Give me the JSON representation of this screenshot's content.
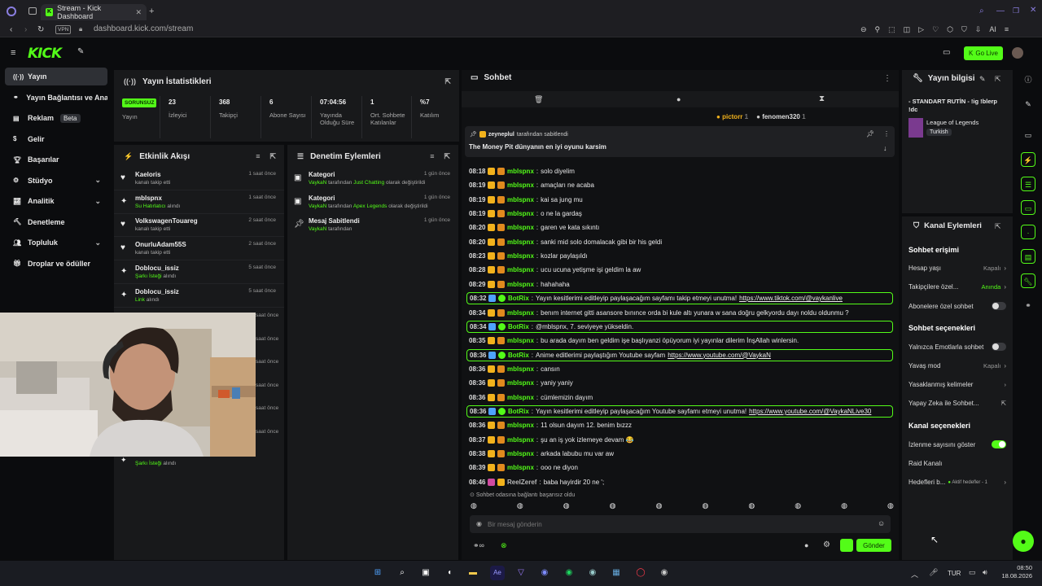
{
  "browser": {
    "tab_title": "Stream - Kick Dashboard",
    "url": "dashboard.kick.com/stream",
    "vpn": "VPN",
    "ai": "AI"
  },
  "header": {
    "logo": "KICK",
    "go_live": "Go Live"
  },
  "sidebar": {
    "items": [
      {
        "label": "Yayın",
        "icon": "broadcast-icon",
        "active": true
      },
      {
        "label": "Yayın Bağlantısı ve Anahtarı",
        "icon": "link-icon"
      },
      {
        "label": "Reklam",
        "icon": "ad-icon",
        "badge": "Beta"
      },
      {
        "label": "Gelir",
        "icon": "dollar-icon"
      },
      {
        "label": "Başarılar",
        "icon": "trophy-icon"
      },
      {
        "label": "Stüdyo",
        "icon": "studio-icon",
        "expand": true
      },
      {
        "label": "Analitik",
        "icon": "chart-icon",
        "expand": true
      },
      {
        "label": "Denetleme",
        "icon": "hammer-icon"
      },
      {
        "label": "Topluluk",
        "icon": "community-icon",
        "expand": true
      },
      {
        "label": "Droplar ve ödüller",
        "icon": "gift-icon"
      }
    ]
  },
  "stats": {
    "title": "Yayın İstatistikleri",
    "status_badge": "SORUNSUZ",
    "items": [
      {
        "value": "",
        "label": "Yayın"
      },
      {
        "value": "23",
        "label": "İzleyici"
      },
      {
        "value": "368",
        "label": "Takipçi"
      },
      {
        "value": "6",
        "label": "Abone Sayısı"
      },
      {
        "value": "07:04:56",
        "label": "Yayında Olduğu Süre"
      },
      {
        "value": "1",
        "label": "Ort. Sohbete Katılanlar"
      },
      {
        "value": "%7",
        "label": "Katılım"
      }
    ]
  },
  "activity": {
    "title": "Etkinlik Akışı",
    "items": [
      {
        "name": "Kaeloris",
        "sub": "kanalı takip etti",
        "time": "1 saat önce",
        "icon": "heart-icon"
      },
      {
        "name": "mblspnx",
        "sub_green": "Su Hatırlatıcı",
        "sub": "alındı",
        "time": "1 saat önce",
        "icon": "reward-icon"
      },
      {
        "name": "VolkswagenTouareg",
        "sub": "kanalı takip etti",
        "time": "2 saat önce",
        "icon": "heart-icon"
      },
      {
        "name": "OnurluAdam55S",
        "sub": "kanalı takip etti",
        "time": "2 saat önce",
        "icon": "heart-icon"
      },
      {
        "name": "Doblocu_issiz",
        "sub_green": "Şarkı İsteği",
        "sub": "alındı",
        "time": "5 saat önce",
        "icon": "reward-icon"
      },
      {
        "name": "Doblocu_issiz",
        "sub_green": "Link",
        "sub": "alındı",
        "time": "5 saat önce",
        "icon": "reward-icon"
      }
    ],
    "hidden_times": [
      "saat önce",
      "saat önce",
      "saat önce",
      "saat önce",
      "saat önce",
      "saat önce"
    ],
    "last_sub_green": "Şarkı İsteği",
    "last_sub": "alındı"
  },
  "moderation": {
    "title": "Denetim Eylemleri",
    "items": [
      {
        "name": "Kategori",
        "actor": "VaykaN",
        "mid": "tarafından",
        "target": "Just Chatting",
        "tail": "olarak değiştirildi",
        "time": "1 gün önce",
        "icon": "category-icon"
      },
      {
        "name": "Kategori",
        "actor": "VaykaN",
        "mid": "tarafından",
        "target": "Apex Legends",
        "tail": "olarak değiştirildi",
        "time": "1 gün önce",
        "icon": "category-icon"
      },
      {
        "name": "Mesaj Sabitlendi",
        "actor": "VaykaN",
        "mid": "tarafından",
        "target": "",
        "tail": "",
        "time": "1 gün önce",
        "icon": "pin-icon"
      }
    ]
  },
  "chat": {
    "title": "Sohbet",
    "top_users": [
      {
        "name": "pictorr",
        "count": "1"
      },
      {
        "name": "fenomen320",
        "count": "1"
      }
    ],
    "pinned_by": "zeyneplul",
    "pinned_by_suffix": "tarafından sabitlendi",
    "pinned_text": "The Money Pit dünyanın en iyi oyunu karsim",
    "messages": [
      {
        "time": "08:18",
        "user": "mblspnx",
        "text": "solo diyelim",
        "bot": false
      },
      {
        "time": "08:19",
        "user": "mblspnx",
        "text": "amaçları ne acaba",
        "bot": false
      },
      {
        "time": "08:19",
        "user": "mblspnx",
        "text": "kai sa jung mu",
        "bot": false
      },
      {
        "time": "08:19",
        "user": "mblspnx",
        "text": "o ne la gardaş",
        "bot": false
      },
      {
        "time": "08:20",
        "user": "mblspnx",
        "text": "garen ve kata sıkıntı",
        "bot": false
      },
      {
        "time": "08:20",
        "user": "mblspnx",
        "text": "sanki mid solo domalacak gibi bir his geldi",
        "bot": false
      },
      {
        "time": "08:23",
        "user": "mblspnx",
        "text": "kozlar paylaşıldı",
        "bot": false
      },
      {
        "time": "08:28",
        "user": "mblspnx",
        "text": "ucu ucuna yetişme işi geldim la aw",
        "bot": false
      },
      {
        "time": "08:29",
        "user": "mblspnx",
        "text": "hahahaha",
        "bot": false
      },
      {
        "time": "08:32",
        "user": "BotRix",
        "text": "Yayın kesitlerimi editleyip paylaşacağım sayfamı takip etmeyi unutma!",
        "link": "https://www.tiktok.com/@vaykanlive",
        "bot": true
      },
      {
        "time": "08:34",
        "user": "mblspnx",
        "text": "benım internet gitti asansore bınınce orda bi kule altı yunara w sana doğru gelkyordu dayı noldu oldunmu ?",
        "bot": false
      },
      {
        "time": "08:34",
        "user": "BotRix",
        "text": "@mblspnx, 7. seviyeye yükseldin.",
        "bot": true
      },
      {
        "time": "08:35",
        "user": "mblspnx",
        "text": "bu arada dayım ben geldim işe başlıyanzi öpüyorum iyi yayınlar dilerim İnşAllah winlersin.",
        "bot": false
      },
      {
        "time": "08:36",
        "user": "BotRix",
        "text": "Anime editlerimi paylaştığım Youtube sayfam",
        "link": "https://www.youtube.com/@VaykaN",
        "bot": true
      },
      {
        "time": "08:36",
        "user": "mblspnx",
        "text": "cansın",
        "bot": false
      },
      {
        "time": "08:36",
        "user": "mblspnx",
        "text": "yaniy yaniy",
        "bot": false
      },
      {
        "time": "08:36",
        "user": "mblspnx",
        "text": "cümlemizin dayım",
        "bot": false
      },
      {
        "time": "08:36",
        "user": "BotRix",
        "text": "Yayın kesitlerimi editleyip paylaşacağım Youtube sayfamı etmeyi unutma!",
        "link": "https://www.youtube.com/@VaykaNLive30",
        "bot": true
      },
      {
        "time": "08:36",
        "user": "mblspnx",
        "text": "11 olsun dayım 12. benim bızzz",
        "bot": false
      },
      {
        "time": "08:37",
        "user": "mblspnx",
        "text": "şu an iş yok izlemeye devam 😂",
        "bot": false
      },
      {
        "time": "08:38",
        "user": "mblspnx",
        "text": "arkada labubu mu var aw",
        "bot": false
      },
      {
        "time": "08:39",
        "user": "mblspnx",
        "text": "ooo ne diyon",
        "bot": false
      },
      {
        "time": "08:46",
        "user": "ReelZeref",
        "text": "baba hayirdir 20 ne ';",
        "bot": false,
        "color": "#b9b9b9"
      }
    ],
    "connected": "Sohbet odasına bağlantı başarısız oldu",
    "placeholder": "Bir mesaj gönderin",
    "send": "Gönder"
  },
  "stream_info": {
    "title": "Yayın bilgisi",
    "stream_title": "- STANDART RUTİN - !ig !blerp !dc",
    "category": "League of Legends",
    "tag": "Turkish"
  },
  "channel_actions": {
    "title": "Kanal Eylemleri",
    "chat_access": "Sohbet erişimi",
    "account_age": {
      "label": "Hesap yaşı",
      "value": "Kapalı"
    },
    "followers_only": {
      "label": "Takipçilere özel...",
      "value": "Anında"
    },
    "subs_only": {
      "label": "Abonelere özel sohbet",
      "on": false
    },
    "chat_options": "Sohbet seçenekleri",
    "emotes_only": {
      "label": "Yalnızca Emotlarla sohbet",
      "on": false
    },
    "slow_mode": {
      "label": "Yavaş mod",
      "value": "Kapalı"
    },
    "banned_words": {
      "label": "Yasaklanmış kelimeler"
    },
    "ai": {
      "label": "Yapay Zeka ile Sohbet..."
    },
    "channel_options": "Kanal seçenekleri",
    "viewer_count": {
      "label": "İzlenme sayısını göster",
      "on": true
    },
    "raid": {
      "label": "Raid Kanalı"
    },
    "goals": {
      "label": "Hedefleri b...",
      "value": "Aktif hedefler - 1"
    }
  },
  "taskbar": {
    "lang": "TUR",
    "time": "08:50",
    "date": "18.08.2026"
  }
}
